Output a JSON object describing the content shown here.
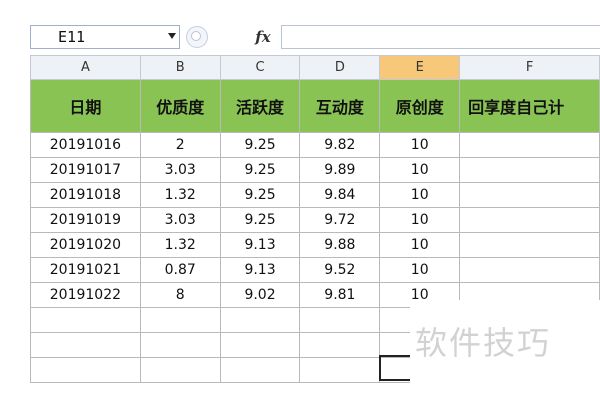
{
  "formula_bar": {
    "name_box": "E11",
    "fx_label": "fx",
    "formula": ""
  },
  "columns": [
    "A",
    "B",
    "C",
    "D",
    "E",
    "F"
  ],
  "selected_column": "E",
  "header_row": [
    "日期",
    "优质度",
    "活跃度",
    "互动度",
    "原创度",
    "回享度自己计"
  ],
  "rows": [
    [
      "20191016",
      "2",
      "9.25",
      "9.82",
      "10",
      ""
    ],
    [
      "20191017",
      "3.03",
      "9.25",
      "9.89",
      "10",
      ""
    ],
    [
      "20191018",
      "1.32",
      "9.25",
      "9.84",
      "10",
      ""
    ],
    [
      "20191019",
      "3.03",
      "9.25",
      "9.72",
      "10",
      ""
    ],
    [
      "20191020",
      "1.32",
      "9.13",
      "9.88",
      "10",
      ""
    ],
    [
      "20191021",
      "0.87",
      "9.13",
      "9.52",
      "10",
      ""
    ],
    [
      "20191022",
      "8",
      "9.02",
      "9.81",
      "10",
      ""
    ]
  ],
  "watermark": "软件技巧",
  "colors": {
    "header_fill": "#89c354",
    "selected_column_fill": "#f8c87a",
    "column_header_fill": "#eef2f7"
  }
}
